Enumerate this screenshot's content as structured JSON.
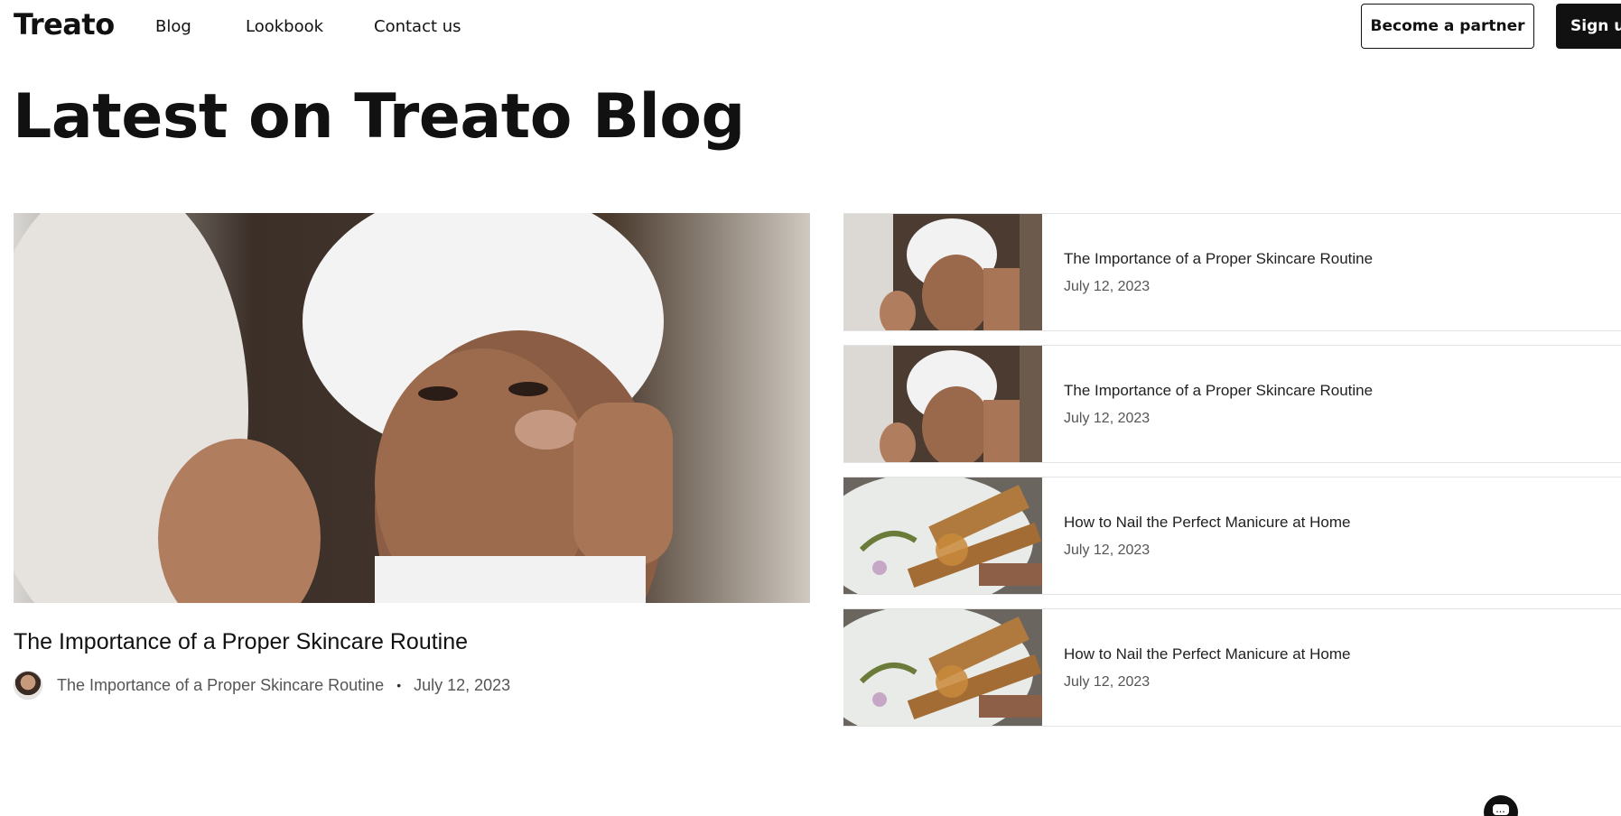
{
  "header": {
    "logo": "Treato",
    "nav": [
      "Blog",
      "Lookbook",
      "Contact us"
    ],
    "partner_button": "Become a partner",
    "signup_button": "Sign up"
  },
  "page_title": "Latest on Treato Blog",
  "featured": {
    "image": "woman-applying-skincare-photo",
    "title": "The Importance of a Proper Skincare Routine",
    "author": "The Importance of a Proper Skincare Routine",
    "separator": "•",
    "date": "July 12, 2023"
  },
  "list": [
    {
      "image": "skincare-thumbnail",
      "title": "The Importance of a Proper Skincare Routine",
      "date": "July 12, 2023"
    },
    {
      "image": "skincare-thumbnail",
      "title": "The Importance of a Proper Skincare Routine",
      "date": "July 12, 2023"
    },
    {
      "image": "manicure-thumbnail",
      "title": "How to Nail the Perfect Manicure at Home",
      "date": "July 12, 2023"
    },
    {
      "image": "manicure-thumbnail",
      "title": "How to Nail the Perfect Manicure at Home",
      "date": "July 12, 2023"
    }
  ],
  "chat": {
    "icon": "chat-bubble-icon",
    "glyph": "..."
  },
  "colors": {
    "primary": "#111111",
    "muted": "#555555",
    "divider": "#e3e3e3"
  }
}
